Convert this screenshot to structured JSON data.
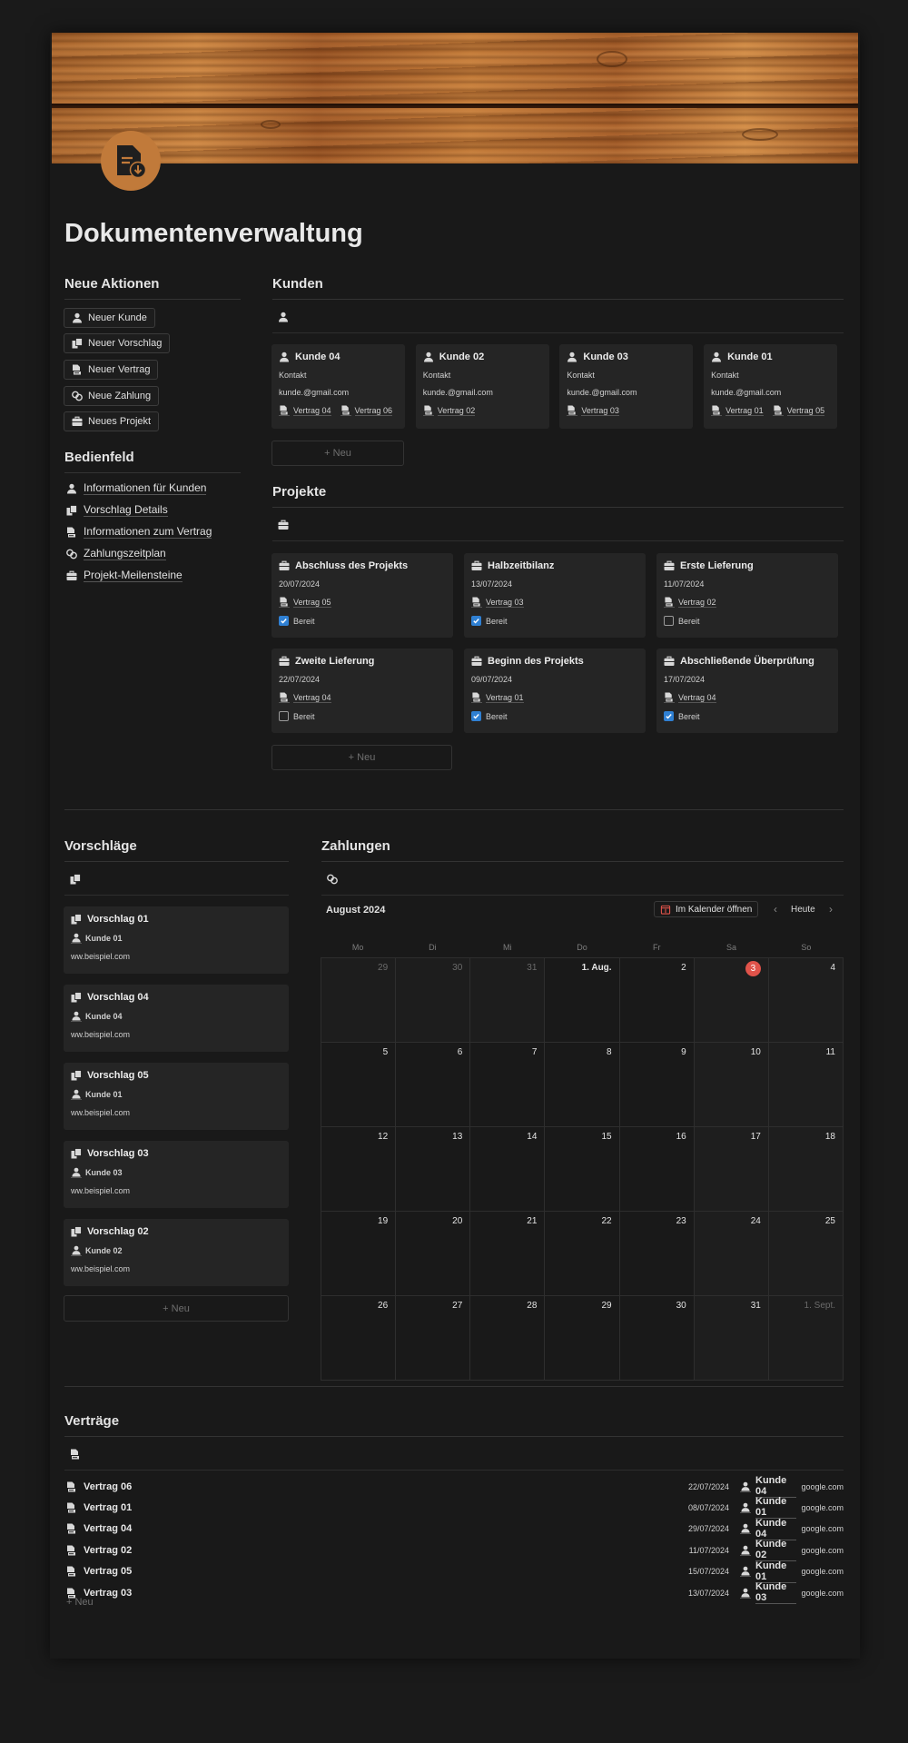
{
  "page": {
    "title": "Dokumentenverwaltung"
  },
  "sections": {
    "neue_aktionen": "Neue Aktionen",
    "bedienfeld": "Bedienfeld",
    "kunden": "Kunden",
    "projekte": "Projekte",
    "vorschlaege": "Vorschläge",
    "zahlungen": "Zahlungen",
    "vertraege": "Verträge"
  },
  "actions": {
    "neuer_kunde": "Neuer Kunde",
    "neuer_vorschlag": "Neuer Vorschlag",
    "neuer_vertrag": "Neuer Vertrag",
    "neue_zahlung": "Neue Zahlung",
    "neues_projekt": "Neues Projekt"
  },
  "nav": {
    "kunden": "Informationen für Kunden",
    "vorschlag": "Vorschlag Details",
    "vertrag": "Informationen zum Vertrag",
    "zahlung": "Zahlungszeitplan",
    "projekt": "Projekt-Meilensteine"
  },
  "common": {
    "new": "Neu",
    "kontakt": "Kontakt",
    "email": "kunde.@gmail.com",
    "ready": "Bereit"
  },
  "customers": [
    {
      "name": "Kunde 04",
      "contracts": [
        "Vertrag 04",
        "Vertrag 06"
      ]
    },
    {
      "name": "Kunde 02",
      "contracts": [
        "Vertrag 02"
      ]
    },
    {
      "name": "Kunde 03",
      "contracts": [
        "Vertrag 03"
      ]
    },
    {
      "name": "Kunde 01",
      "contracts": [
        "Vertrag 01",
        "Vertrag 05"
      ]
    }
  ],
  "projects": [
    {
      "name": "Abschluss des Projekts",
      "date": "20/07/2024",
      "contract": "Vertrag 05",
      "ready": true
    },
    {
      "name": "Halbzeitbilanz",
      "date": "13/07/2024",
      "contract": "Vertrag 03",
      "ready": true
    },
    {
      "name": "Erste Lieferung",
      "date": "11/07/2024",
      "contract": "Vertrag 02",
      "ready": false
    },
    {
      "name": "Zweite Lieferung",
      "date": "22/07/2024",
      "contract": "Vertrag 04",
      "ready": false
    },
    {
      "name": "Beginn des Projekts",
      "date": "09/07/2024",
      "contract": "Vertrag 01",
      "ready": true
    },
    {
      "name": "Abschließende Überprüfung",
      "date": "17/07/2024",
      "contract": "Vertrag 04",
      "ready": true
    }
  ],
  "proposals": [
    {
      "name": "Vorschlag 01",
      "customer": "Kunde 01",
      "url": "ww.beispiel.com"
    },
    {
      "name": "Vorschlag 04",
      "customer": "Kunde 04",
      "url": "ww.beispiel.com"
    },
    {
      "name": "Vorschlag 05",
      "customer": "Kunde 01",
      "url": "ww.beispiel.com"
    },
    {
      "name": "Vorschlag 03",
      "customer": "Kunde 03",
      "url": "ww.beispiel.com"
    },
    {
      "name": "Vorschlag 02",
      "customer": "Kunde 02",
      "url": "ww.beispiel.com"
    }
  ],
  "calendar": {
    "month": "August 2024",
    "open_label": "Im Kalender öffnen",
    "today_label": "Heute",
    "weekdays": [
      "Mo",
      "Di",
      "Mi",
      "Do",
      "Fr",
      "Sa",
      "So"
    ],
    "days": [
      "29",
      "30",
      "31",
      "1. Aug.",
      "2",
      "3",
      "4",
      "5",
      "6",
      "7",
      "8",
      "9",
      "10",
      "11",
      "12",
      "13",
      "14",
      "15",
      "16",
      "17",
      "18",
      "19",
      "20",
      "21",
      "22",
      "23",
      "24",
      "25",
      "26",
      "27",
      "28",
      "29",
      "30",
      "31",
      "1. Sept."
    ],
    "today": "3"
  },
  "contracts": [
    {
      "name": "Vertrag 06",
      "date": "22/07/2024",
      "customer": "Kunde 04",
      "url": "google.com"
    },
    {
      "name": "Vertrag 01",
      "date": "08/07/2024",
      "customer": "Kunde 01",
      "url": "google.com"
    },
    {
      "name": "Vertrag 04",
      "date": "29/07/2024",
      "customer": "Kunde 04",
      "url": "google.com"
    },
    {
      "name": "Vertrag 02",
      "date": "11/07/2024",
      "customer": "Kunde 02",
      "url": "google.com"
    },
    {
      "name": "Vertrag 05",
      "date": "15/07/2024",
      "customer": "Kunde 01",
      "url": "google.com"
    },
    {
      "name": "Vertrag 03",
      "date": "13/07/2024",
      "customer": "Kunde 03",
      "url": "google.com"
    }
  ],
  "colors": {
    "accent": "#c17a3a",
    "today": "#e0534a",
    "checkbox": "#2f80d3",
    "card": "#252525"
  }
}
